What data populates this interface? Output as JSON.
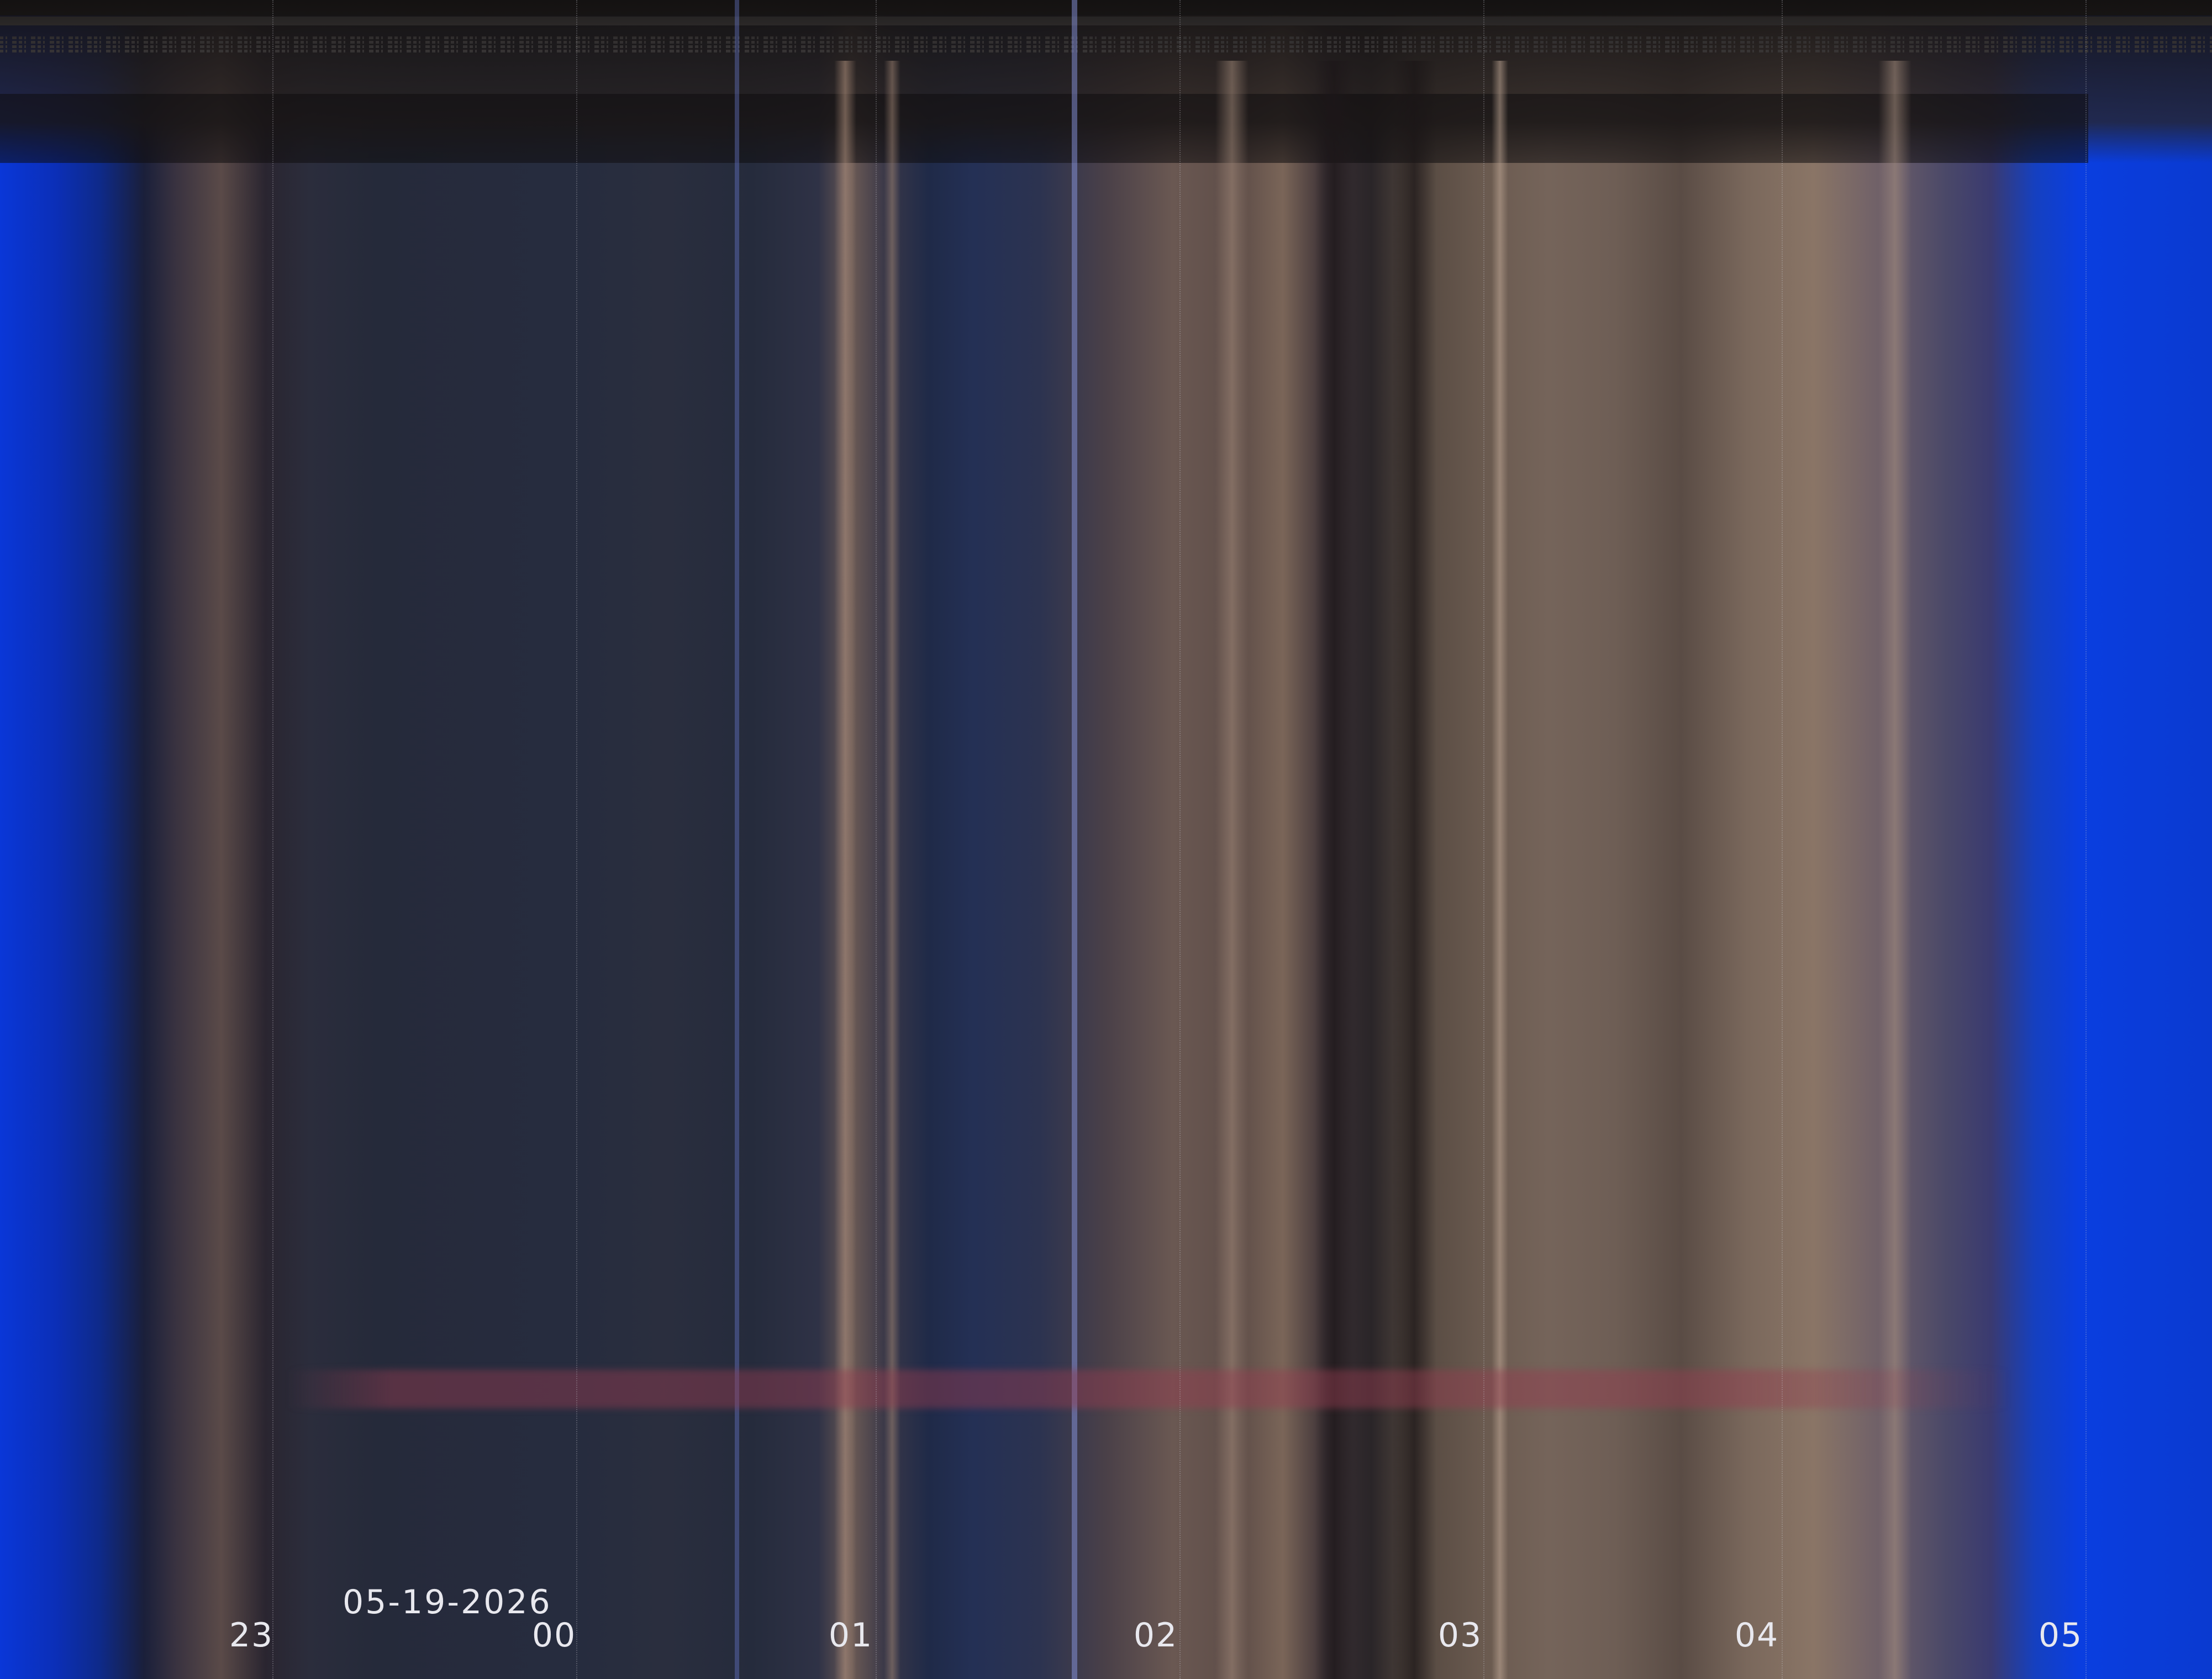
{
  "timeline": {
    "date": "05-19-2026",
    "ticks": [
      "23",
      "00",
      "01",
      "02",
      "03",
      "04",
      "05"
    ]
  },
  "colors": {
    "edge_blue": "#0a3ad0",
    "band_red": "#963c50",
    "label_white": "#e8e8ee"
  }
}
